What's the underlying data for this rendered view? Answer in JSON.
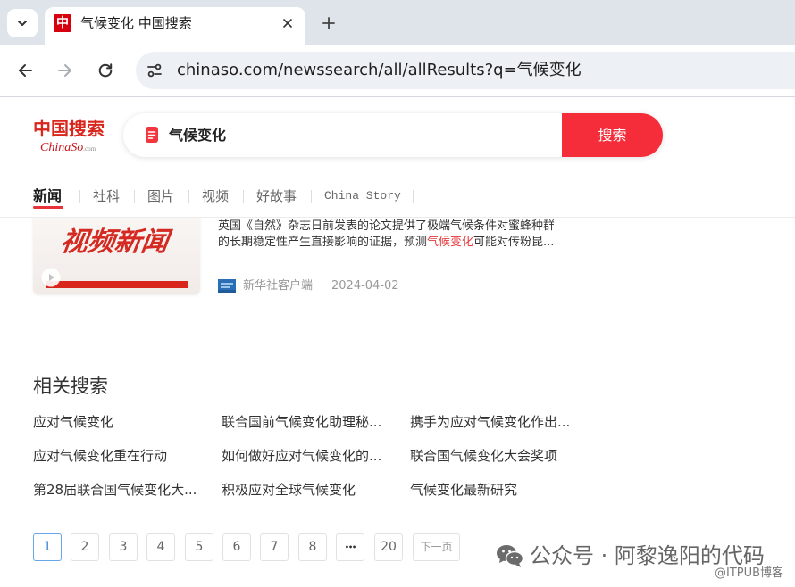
{
  "browser": {
    "tab": {
      "favicon_text": "中",
      "title": "气候变化 中国搜索"
    },
    "omnibox": {
      "url": "chinaso.com/newssearch/all/allResults?q=气候变化"
    }
  },
  "header": {
    "logo": {
      "name": "中国搜索",
      "latin": "ChinaSo",
      "suffix": ".com"
    },
    "search": {
      "query": "气候变化",
      "button_label": "搜索"
    },
    "tabs": [
      {
        "label": "新闻",
        "active": true
      },
      {
        "label": "社科",
        "active": false
      },
      {
        "label": "图片",
        "active": false
      },
      {
        "label": "视频",
        "active": false
      },
      {
        "label": "好故事",
        "active": false
      },
      {
        "label": "China Story",
        "active": false
      }
    ]
  },
  "result": {
    "thumbnail_text": "视频新闻",
    "snippet": {
      "line1": "英国《自然》杂志日前发表的论文提供了极端气候条件对蜜蜂种群",
      "line2_before": "的长期稳定性产生直接影响的证据，预测",
      "highlight": "气候变化",
      "line2_after": "可能对传粉昆..."
    },
    "source": "新华社客户端",
    "date": "2024-04-02"
  },
  "related": {
    "heading": "相关搜索",
    "items": [
      "应对气候变化",
      "联合国前气候变化助理秘...",
      "携手为应对气候变化作出...",
      "应对气候变化重在行动",
      "如何做好应对气候变化的...",
      "联合国气候变化大会奖项",
      "第28届联合国气候变化大...",
      "积极应对全球气候变化",
      "气候变化最新研究"
    ]
  },
  "pagination": {
    "current": 1,
    "pages": [
      "1",
      "2",
      "3",
      "4",
      "5",
      "6",
      "7",
      "8"
    ],
    "ellipsis": "•••",
    "last": "20",
    "next_label": "下一页"
  },
  "watermark": {
    "text": "公众号 · 阿黎逸阳的代码",
    "credit": "@ITPUB博客"
  },
  "icons": [
    "chevron-down-icon",
    "close-icon",
    "plus-icon",
    "back-arrow-icon",
    "forward-arrow-icon",
    "reload-icon",
    "site-info-icon",
    "document-icon",
    "play-icon",
    "xinhua-logo-icon",
    "wechat-icon"
  ],
  "colors": {
    "brand_red": "#d9261c",
    "search_button_red": "#f52d3a",
    "highlight_red": "#e4393c",
    "active_page_blue": "#3d86d8",
    "tab_strip": "#dfe4ea",
    "omnibox": "#edf0f5"
  }
}
